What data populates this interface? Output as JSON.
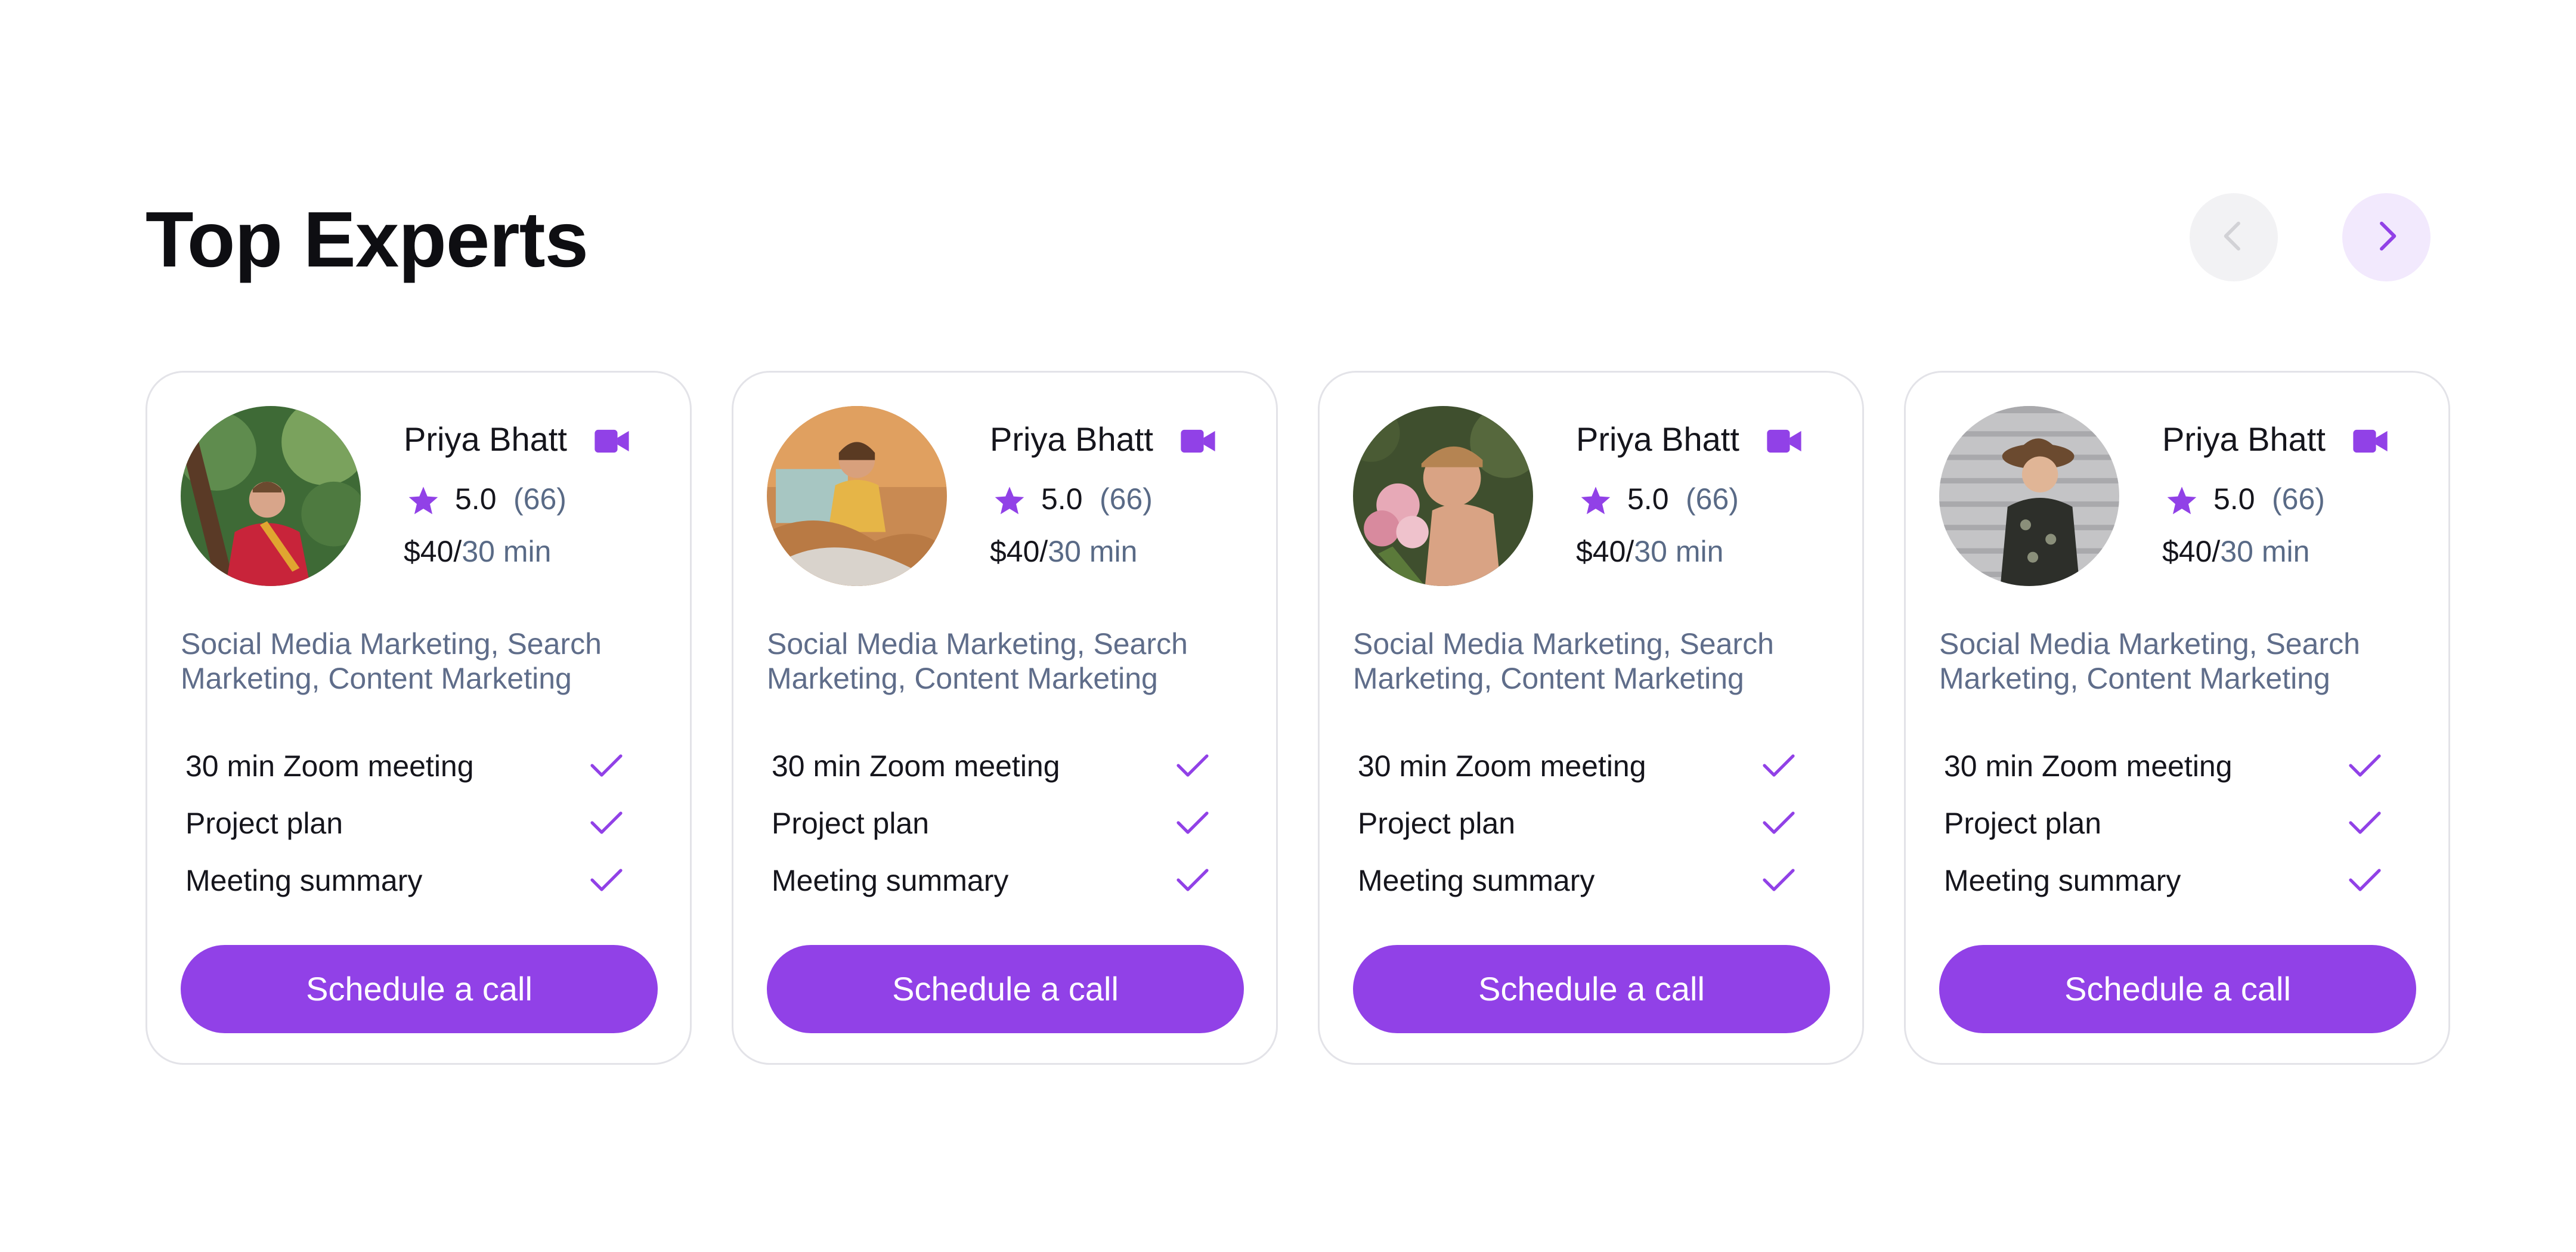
{
  "page": {
    "title": "Top Experts"
  },
  "nav": {
    "prev_icon": "chevron-left-icon",
    "next_icon": "chevron-right-icon",
    "prev_enabled": false,
    "next_enabled": true
  },
  "colors": {
    "accent": "#9141e7",
    "accent_light": "#f2e9fd",
    "text_primary": "#15151c",
    "text_muted": "#596a86",
    "card_border": "#e3e3e8"
  },
  "experts": [
    {
      "name": "Priya Bhatt",
      "rating": "5.0",
      "reviews": "(66)",
      "price_amount": "$40/",
      "price_unit": "30 min",
      "skills": "Social Media Marketing, Search Marketing, Content Marketing",
      "features": [
        "30 min Zoom meeting",
        "Project plan",
        "Meeting summary"
      ],
      "cta": "Schedule a call"
    },
    {
      "name": "Priya Bhatt",
      "rating": "5.0",
      "reviews": "(66)",
      "price_amount": "$40/",
      "price_unit": "30 min",
      "skills": "Social Media Marketing, Search Marketing, Content Marketing",
      "features": [
        "30 min Zoom meeting",
        "Project plan",
        "Meeting summary"
      ],
      "cta": "Schedule a call"
    },
    {
      "name": "Priya Bhatt",
      "rating": "5.0",
      "reviews": "(66)",
      "price_amount": "$40/",
      "price_unit": "30 min",
      "skills": "Social Media Marketing, Search Marketing, Content Marketing",
      "features": [
        "30 min Zoom meeting",
        "Project plan",
        "Meeting summary"
      ],
      "cta": "Schedule a call"
    },
    {
      "name": "Priya Bhatt",
      "rating": "5.0",
      "reviews": "(66)",
      "price_amount": "$40/",
      "price_unit": "30 min",
      "skills": "Social Media Marketing, Search Marketing, Content Marketing",
      "features": [
        "30 min Zoom meeting",
        "Project plan",
        "Meeting summary"
      ],
      "cta": "Schedule a call"
    }
  ]
}
